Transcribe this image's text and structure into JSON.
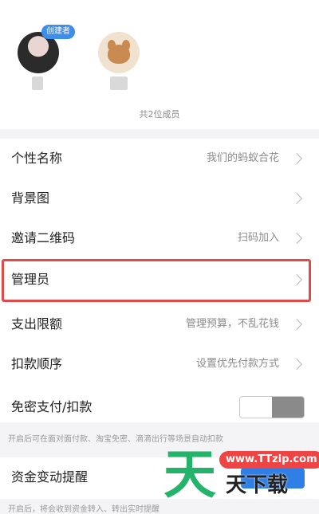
{
  "members": {
    "creator_badge": "创建者",
    "count_text": "共2位成员"
  },
  "settings": [
    {
      "label": "个性名称",
      "value": "我们的蚂蚁合花"
    },
    {
      "label": "背景图",
      "value": ""
    },
    {
      "label": "邀请二维码",
      "value": "扫码加入"
    },
    {
      "label": "管理员",
      "value": ""
    },
    {
      "label": "支出限额",
      "value": "管理预算，不乱花钱"
    },
    {
      "label": "扣款顺序",
      "value": "设置优先付款方式"
    },
    {
      "label": "免密支付/扣款",
      "value": ""
    }
  ],
  "password_free_note": "开启后可在面对面付款、淘宝免密、滴滴出行等场景自动扣款",
  "fund_change": {
    "label": "资金变动提醒",
    "note": "开启后，将会收到资金转入、转出实时提醒"
  },
  "watermark": {
    "big_char": "天",
    "site": "www.TTzip.com",
    "text": "天下载"
  },
  "colors": {
    "accent": "#3d8dea",
    "highlight": "#e24a4a",
    "watermark_green": "#24b36b"
  }
}
